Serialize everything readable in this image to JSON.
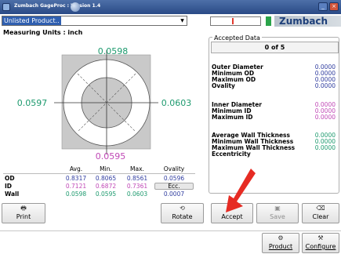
{
  "window": {
    "title": "Zumbach GageProc : Version 1.4"
  },
  "product": {
    "selected": "Unlisted Product.."
  },
  "units_label": "Measuring Units : inch",
  "logo_text": "Zumbach",
  "gauge": {
    "top": "0.0598",
    "left": "0.0597",
    "right": "0.0603",
    "bottom": "0.0595"
  },
  "table": {
    "headers": [
      "Avg.",
      "Min.",
      "Max.",
      "Ovality"
    ],
    "rows": [
      {
        "label": "OD",
        "values": [
          "0.8317",
          "0.8065",
          "0.8561",
          "0.0596"
        ]
      },
      {
        "label": "ID",
        "values": [
          "0.7121",
          "0.6872",
          "0.7361"
        ],
        "ecc_label": "Ecc."
      },
      {
        "label": "Wall",
        "values": [
          "0.0598",
          "0.0595",
          "0.0603",
          "0.0007"
        ]
      }
    ]
  },
  "buttons": {
    "print": "Print",
    "rotate": "Rotate",
    "accept": "Accept",
    "save": "Save",
    "clear": "Clear",
    "product": "Product",
    "configure": "Configure"
  },
  "accepted": {
    "title": "Accepted Data",
    "counter": "0 of 5",
    "od_group": [
      {
        "label": "Outer Diameter",
        "value": "0.0000"
      },
      {
        "label": "Minimum OD",
        "value": "0.0000"
      },
      {
        "label": "Maximum OD",
        "value": "0.0000"
      },
      {
        "label": "Ovality",
        "value": "0.0000"
      }
    ],
    "id_group": [
      {
        "label": "Inner Diameter",
        "value": "0.0000"
      },
      {
        "label": "Minimum ID",
        "value": "0.0000"
      },
      {
        "label": "Maximum ID",
        "value": "0.0000"
      }
    ],
    "wall_group": [
      {
        "label": "Average Wall Thickness",
        "value": "0.0000"
      },
      {
        "label": "Minimum Wall Thickness",
        "value": "0.0000"
      },
      {
        "label": "Maximum Wall Thickness",
        "value": "0.0000"
      },
      {
        "label": "Eccentricity",
        "value": ""
      }
    ]
  },
  "colors": {
    "od": "#2f3c9f",
    "id": "#c048b6",
    "wall": "#1d9a6e"
  }
}
